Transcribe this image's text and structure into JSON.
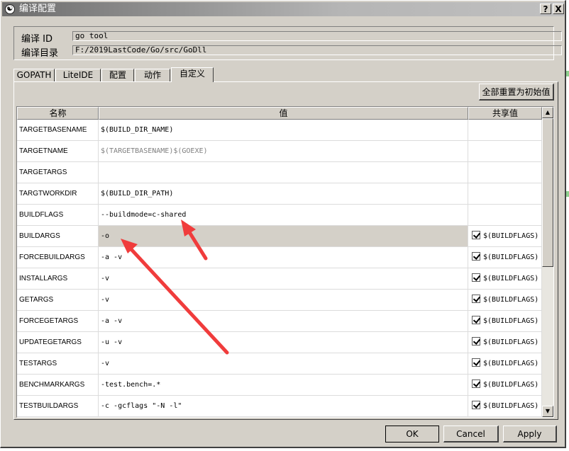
{
  "window": {
    "title": "编译配置",
    "help_label": "?",
    "close_label": "X"
  },
  "info": {
    "build_id_label": "编译 ID",
    "build_id_value": "go tool",
    "build_dir_label": "编译目录",
    "build_dir_value": "F:/2019LastCode/Go/src/GoDll"
  },
  "tabs": [
    {
      "label": "GOPATH"
    },
    {
      "label": "LiteIDE"
    },
    {
      "label": "配置"
    },
    {
      "label": "动作"
    },
    {
      "label": "自定义"
    }
  ],
  "active_tab": "自定义",
  "reset_button": "全部重置为初始值",
  "table": {
    "headers": {
      "name": "名称",
      "value": "值",
      "shared": "共享值"
    },
    "rows": [
      {
        "name": "TARGETBASENAME",
        "value": "$(BUILD_DIR_NAME)",
        "shared": ""
      },
      {
        "name": "TARGETNAME",
        "value": "$(TARGETBASENAME)$(GOEXE)",
        "shared": ""
      },
      {
        "name": "TARGETARGS",
        "value": "",
        "shared": ""
      },
      {
        "name": "TARGTWORKDIR",
        "value": "$(BUILD_DIR_PATH)",
        "shared": ""
      },
      {
        "name": "BUILDFLAGS",
        "value": "--buildmode=c-shared",
        "shared": ""
      },
      {
        "name": "BUILDARGS",
        "value": "-o",
        "shared": "$(BUILDFLAGS)"
      },
      {
        "name": "FORCEBUILDARGS",
        "value": "-a -v",
        "shared": "$(BUILDFLAGS)"
      },
      {
        "name": "INSTALLARGS",
        "value": "-v",
        "shared": "$(BUILDFLAGS)"
      },
      {
        "name": "GETARGS",
        "value": "-v",
        "shared": "$(BUILDFLAGS)"
      },
      {
        "name": "FORCEGETARGS",
        "value": "-a -v",
        "shared": "$(BUILDFLAGS)"
      },
      {
        "name": "UPDATEGETARGS",
        "value": "-u -v",
        "shared": "$(BUILDFLAGS)"
      },
      {
        "name": "TESTARGS",
        "value": "-v",
        "shared": "$(BUILDFLAGS)"
      },
      {
        "name": "BENCHMARKARGS",
        "value": "-test.bench=.*",
        "shared": "$(BUILDFLAGS)"
      },
      {
        "name": "TESTBUILDARGS",
        "value": "-c -gcflags \"-N -l\"",
        "shared": "$(BUILDFLAGS)"
      }
    ]
  },
  "buttons": {
    "ok": "OK",
    "cancel": "Cancel",
    "apply": "Apply"
  },
  "colors": {
    "annotation_arrow": "#f03c3c",
    "selected_row": "#d4d0c8",
    "dialog_face": "#d4d0c8"
  }
}
